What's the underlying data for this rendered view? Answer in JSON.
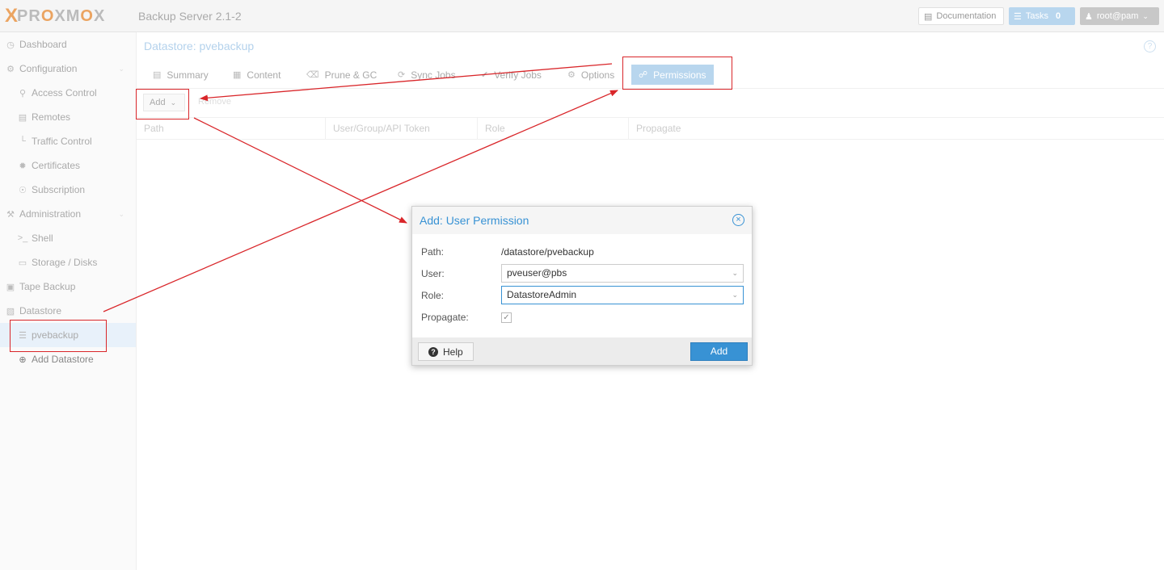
{
  "header": {
    "logo_x": "X",
    "logo_text_a": "PR",
    "logo_text_o1": "O",
    "logo_text_b": "XM",
    "logo_text_o2": "O",
    "logo_text_c": "X",
    "product": "Backup Server 2.1-2",
    "documentation_label": "Documentation",
    "tasks_label": "Tasks",
    "tasks_count": "0",
    "user_label": "root@pam"
  },
  "sidebar": {
    "items": [
      {
        "label": "Dashboard",
        "icon": "tachometer-icon"
      },
      {
        "label": "Configuration",
        "icon": "gears-icon"
      },
      {
        "label": "Access Control",
        "icon": "key-icon"
      },
      {
        "label": "Remotes",
        "icon": "server-icon"
      },
      {
        "label": "Traffic Control",
        "icon": "chart-icon"
      },
      {
        "label": "Certificates",
        "icon": "certificate-icon"
      },
      {
        "label": "Subscription",
        "icon": "support-icon"
      },
      {
        "label": "Administration",
        "icon": "wrench-icon"
      },
      {
        "label": "Shell",
        "icon": "terminal-icon"
      },
      {
        "label": "Storage / Disks",
        "icon": "hdd-icon"
      },
      {
        "label": "Tape Backup",
        "icon": "tape-icon"
      },
      {
        "label": "Datastore",
        "icon": "archive-icon"
      },
      {
        "label": "pvebackup",
        "icon": "database-icon"
      },
      {
        "label": "Add Datastore",
        "icon": "plus-circle-icon"
      }
    ]
  },
  "main": {
    "title": "Datastore: pvebackup",
    "tabs": [
      {
        "label": "Summary",
        "icon": "book-icon"
      },
      {
        "label": "Content",
        "icon": "th-icon"
      },
      {
        "label": "Prune & GC",
        "icon": "trash-icon"
      },
      {
        "label": "Sync Jobs",
        "icon": "refresh-icon"
      },
      {
        "label": "Verify Jobs",
        "icon": "check-circle-icon"
      },
      {
        "label": "Options",
        "icon": "gear-icon"
      },
      {
        "label": "Permissions",
        "icon": "unlock-icon"
      }
    ],
    "toolbar": {
      "add_label": "Add",
      "remove_label": "Remove"
    },
    "columns": [
      "Path",
      "User/Group/API Token",
      "Role",
      "Propagate"
    ]
  },
  "dialog": {
    "title": "Add: User Permission",
    "path_label": "Path:",
    "path_value": "/datastore/pvebackup",
    "user_label": "User:",
    "user_value": "pveuser@pbs",
    "role_label": "Role:",
    "role_value": "DatastoreAdmin",
    "propagate_label": "Propagate:",
    "propagate_checked": true,
    "help_label": "Help",
    "add_label": "Add"
  },
  "colors": {
    "accent": "#3892d4",
    "annotation_red": "#d9262a",
    "brand_orange": "#e57000"
  }
}
